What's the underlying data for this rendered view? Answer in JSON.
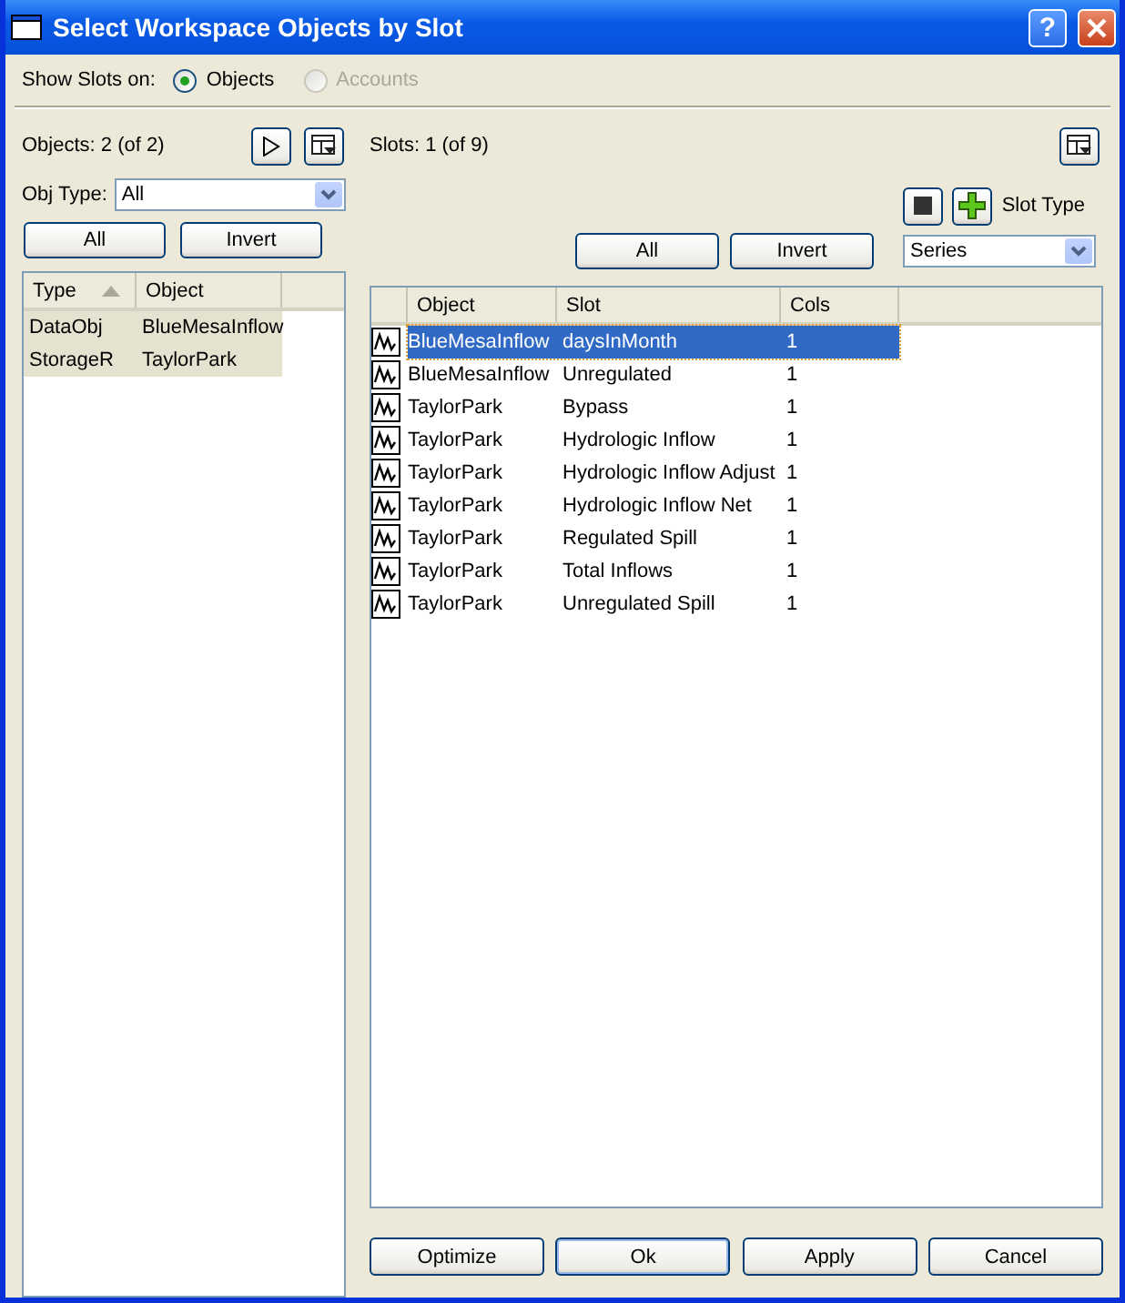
{
  "window": {
    "title": "Select Workspace Objects by Slot",
    "help": "?"
  },
  "show_slots": {
    "label": "Show Slots on:",
    "options": [
      {
        "label": "Objects",
        "selected": true,
        "disabled": false
      },
      {
        "label": "Accounts",
        "selected": false,
        "disabled": true
      }
    ]
  },
  "objects_panel": {
    "count": "Objects: 2 (of 2)",
    "obj_type": {
      "label": "Obj Type:",
      "value": "All"
    },
    "buttons": [
      "All",
      "Invert"
    ],
    "columns": [
      {
        "label": "Type",
        "sorted": true
      },
      {
        "label": "Object",
        "sorted": false
      }
    ],
    "rows": [
      {
        "type": "DataObj",
        "object": "BlueMesaInflow",
        "selected": true
      },
      {
        "type": "StorageR",
        "object": "TaylorPark",
        "selected": true
      }
    ]
  },
  "slots_panel": {
    "count": "Slots: 1 (of 9)",
    "slot_type": {
      "label": "Slot Type",
      "value": "Series"
    },
    "buttons": [
      "All",
      "Invert"
    ],
    "columns": [
      "Object",
      "Slot",
      "Cols"
    ],
    "rows": [
      {
        "object": "BlueMesaInflow",
        "slot": "daysInMonth",
        "cols": "1",
        "selected": true
      },
      {
        "object": "BlueMesaInflow",
        "slot": "Unregulated",
        "cols": "1",
        "selected": false
      },
      {
        "object": "TaylorPark",
        "slot": "Bypass",
        "cols": "1",
        "selected": false
      },
      {
        "object": "TaylorPark",
        "slot": "Hydrologic Inflow",
        "cols": "1",
        "selected": false
      },
      {
        "object": "TaylorPark",
        "slot": "Hydrologic Inflow Adjust",
        "cols": "1",
        "selected": false
      },
      {
        "object": "TaylorPark",
        "slot": "Hydrologic Inflow Net",
        "cols": "1",
        "selected": false
      },
      {
        "object": "TaylorPark",
        "slot": "Regulated Spill",
        "cols": "1",
        "selected": false
      },
      {
        "object": "TaylorPark",
        "slot": "Total Inflows",
        "cols": "1",
        "selected": false
      },
      {
        "object": "TaylorPark",
        "slot": "Unregulated Spill",
        "cols": "1",
        "selected": false
      }
    ]
  },
  "buttons": [
    {
      "label": "Optimize",
      "default": false
    },
    {
      "label": "Ok",
      "default": true
    },
    {
      "label": "Apply",
      "default": false
    },
    {
      "label": "Cancel",
      "default": false
    }
  ]
}
